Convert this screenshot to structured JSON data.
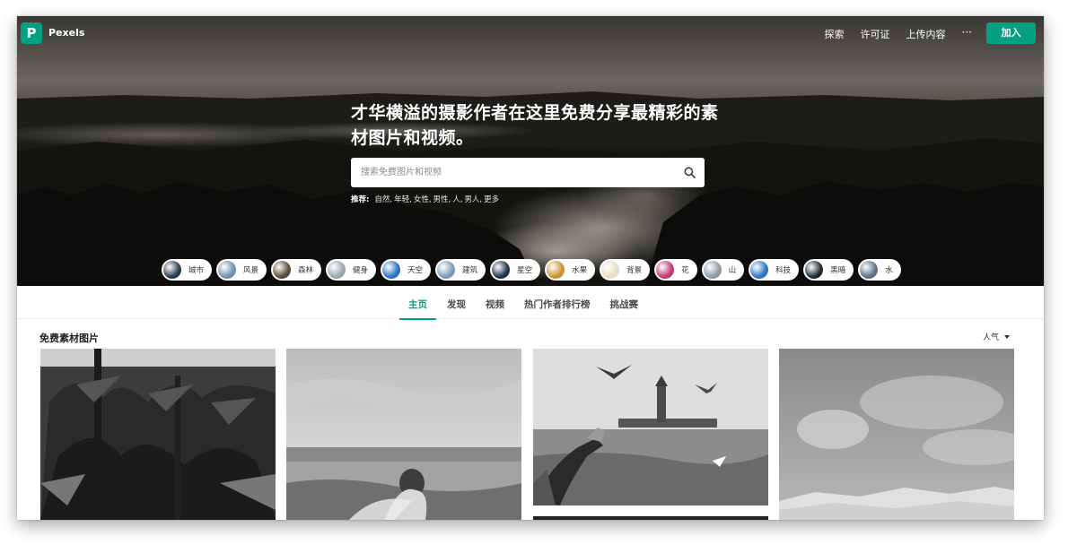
{
  "brand": {
    "name": "Pexels",
    "logo_letter": "P",
    "accent": "#05a081"
  },
  "nav": {
    "items": [
      "探索",
      "许可证",
      "上传内容"
    ],
    "more": "···",
    "join_label": "加入"
  },
  "hero": {
    "headline": "才华横溢的摄影作者在这里免费分享最精彩的素材图片和视频。",
    "search_placeholder": "搜索免费图片和视频",
    "suggest_label": "推荐:",
    "suggestions": [
      "自然,",
      "年轻,",
      "女性,",
      "男性,",
      "人,",
      "男人,",
      "更多"
    ]
  },
  "categories": [
    {
      "label": "城市",
      "color": "#2b3a4a"
    },
    {
      "label": "风景",
      "color": "#6f8fa8"
    },
    {
      "label": "森林",
      "color": "#5a4a34"
    },
    {
      "label": "健身",
      "color": "#9aa4aa"
    },
    {
      "label": "天空",
      "color": "#2d6fc4"
    },
    {
      "label": "建筑",
      "color": "#7c9ab6"
    },
    {
      "label": "星空",
      "color": "#1e2f47"
    },
    {
      "label": "水果",
      "color": "#c99233"
    },
    {
      "label": "背景",
      "color": "#e8dcc2"
    },
    {
      "label": "花",
      "color": "#c2386f"
    },
    {
      "label": "山",
      "color": "#8f9aa3"
    },
    {
      "label": "科技",
      "color": "#2b74c7"
    },
    {
      "label": "黑暗",
      "color": "#1c2730"
    },
    {
      "label": "水",
      "color": "#5b6e8a"
    }
  ],
  "tabs": [
    "主页",
    "发现",
    "视频",
    "热门作者排行榜",
    "挑战赛"
  ],
  "section": {
    "title": "免费素材图片",
    "sort_label": "人气"
  }
}
